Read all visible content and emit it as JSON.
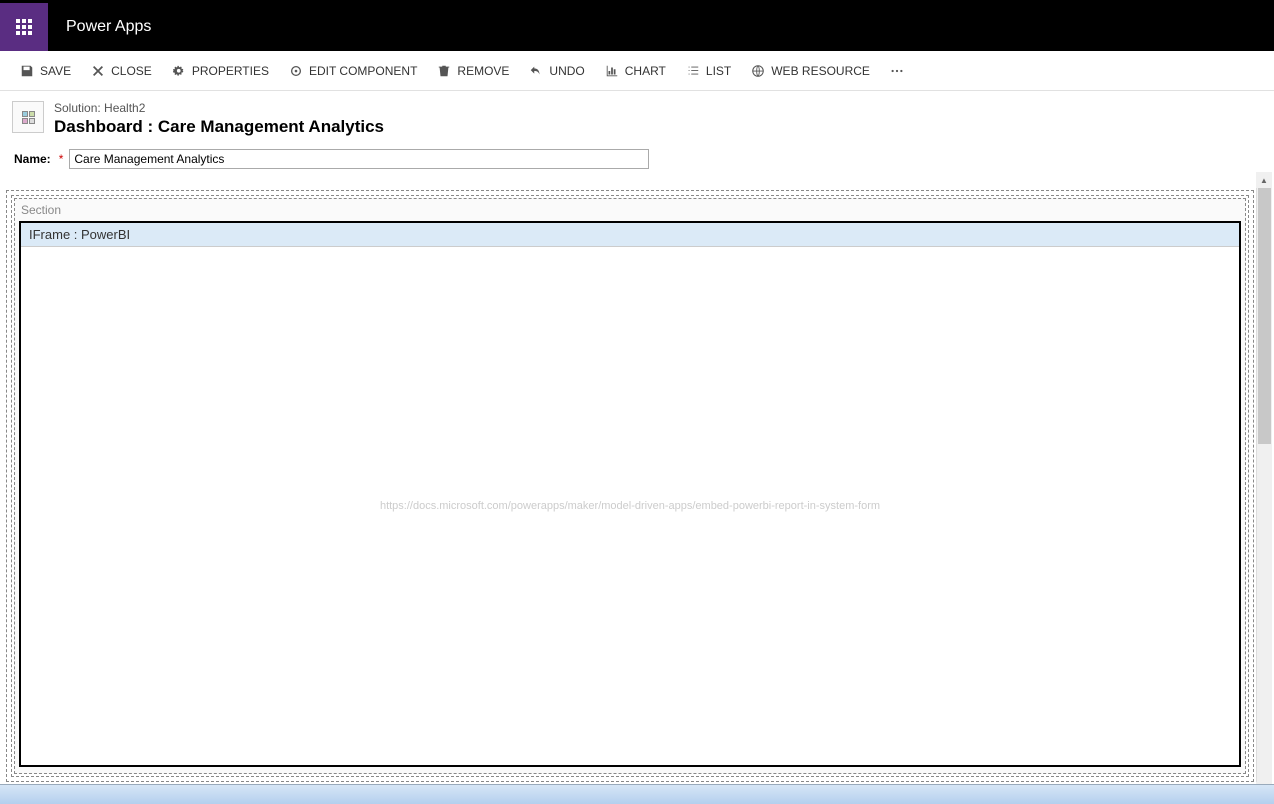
{
  "header": {
    "app_title": "Power Apps"
  },
  "toolbar": {
    "save": "SAVE",
    "close": "CLOSE",
    "properties": "PROPERTIES",
    "edit_component": "EDIT COMPONENT",
    "remove": "REMOVE",
    "undo": "UNDO",
    "chart": "CHART",
    "list": "LIST",
    "web_resource": "WEB RESOURCE"
  },
  "context": {
    "solution_label": "Solution: Health2",
    "dashboard_label": "Dashboard : Care Management Analytics"
  },
  "name_field": {
    "label": "Name:",
    "value": "Care Management Analytics"
  },
  "canvas": {
    "section_label": "Section",
    "iframe_title": "IFrame : PowerBI",
    "iframe_hint": "https://docs.microsoft.com/powerapps/maker/model-driven-apps/embed-powerbi-report-in-system-form"
  }
}
